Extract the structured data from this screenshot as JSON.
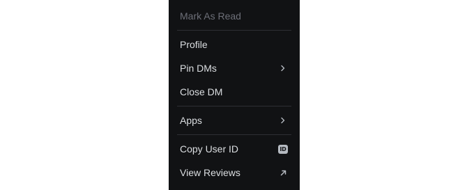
{
  "menu": {
    "items": [
      {
        "label": "Mark As Read"
      },
      {
        "label": "Profile"
      },
      {
        "label": "Pin DMs",
        "icon": "chevron-right-icon"
      },
      {
        "label": "Close DM"
      },
      {
        "label": "Apps",
        "icon": "chevron-right-icon"
      },
      {
        "label": "Copy User ID",
        "icon": "id-badge-icon",
        "badge_text": "ID"
      },
      {
        "label": "View Reviews",
        "icon": "external-link-arrow-icon"
      }
    ]
  },
  "colors": {
    "background": "#111214",
    "text": "#dbdee1",
    "disabled_text": "#6d6f78",
    "separator": "#2e2f34",
    "badge_bg": "#b5bac1"
  }
}
